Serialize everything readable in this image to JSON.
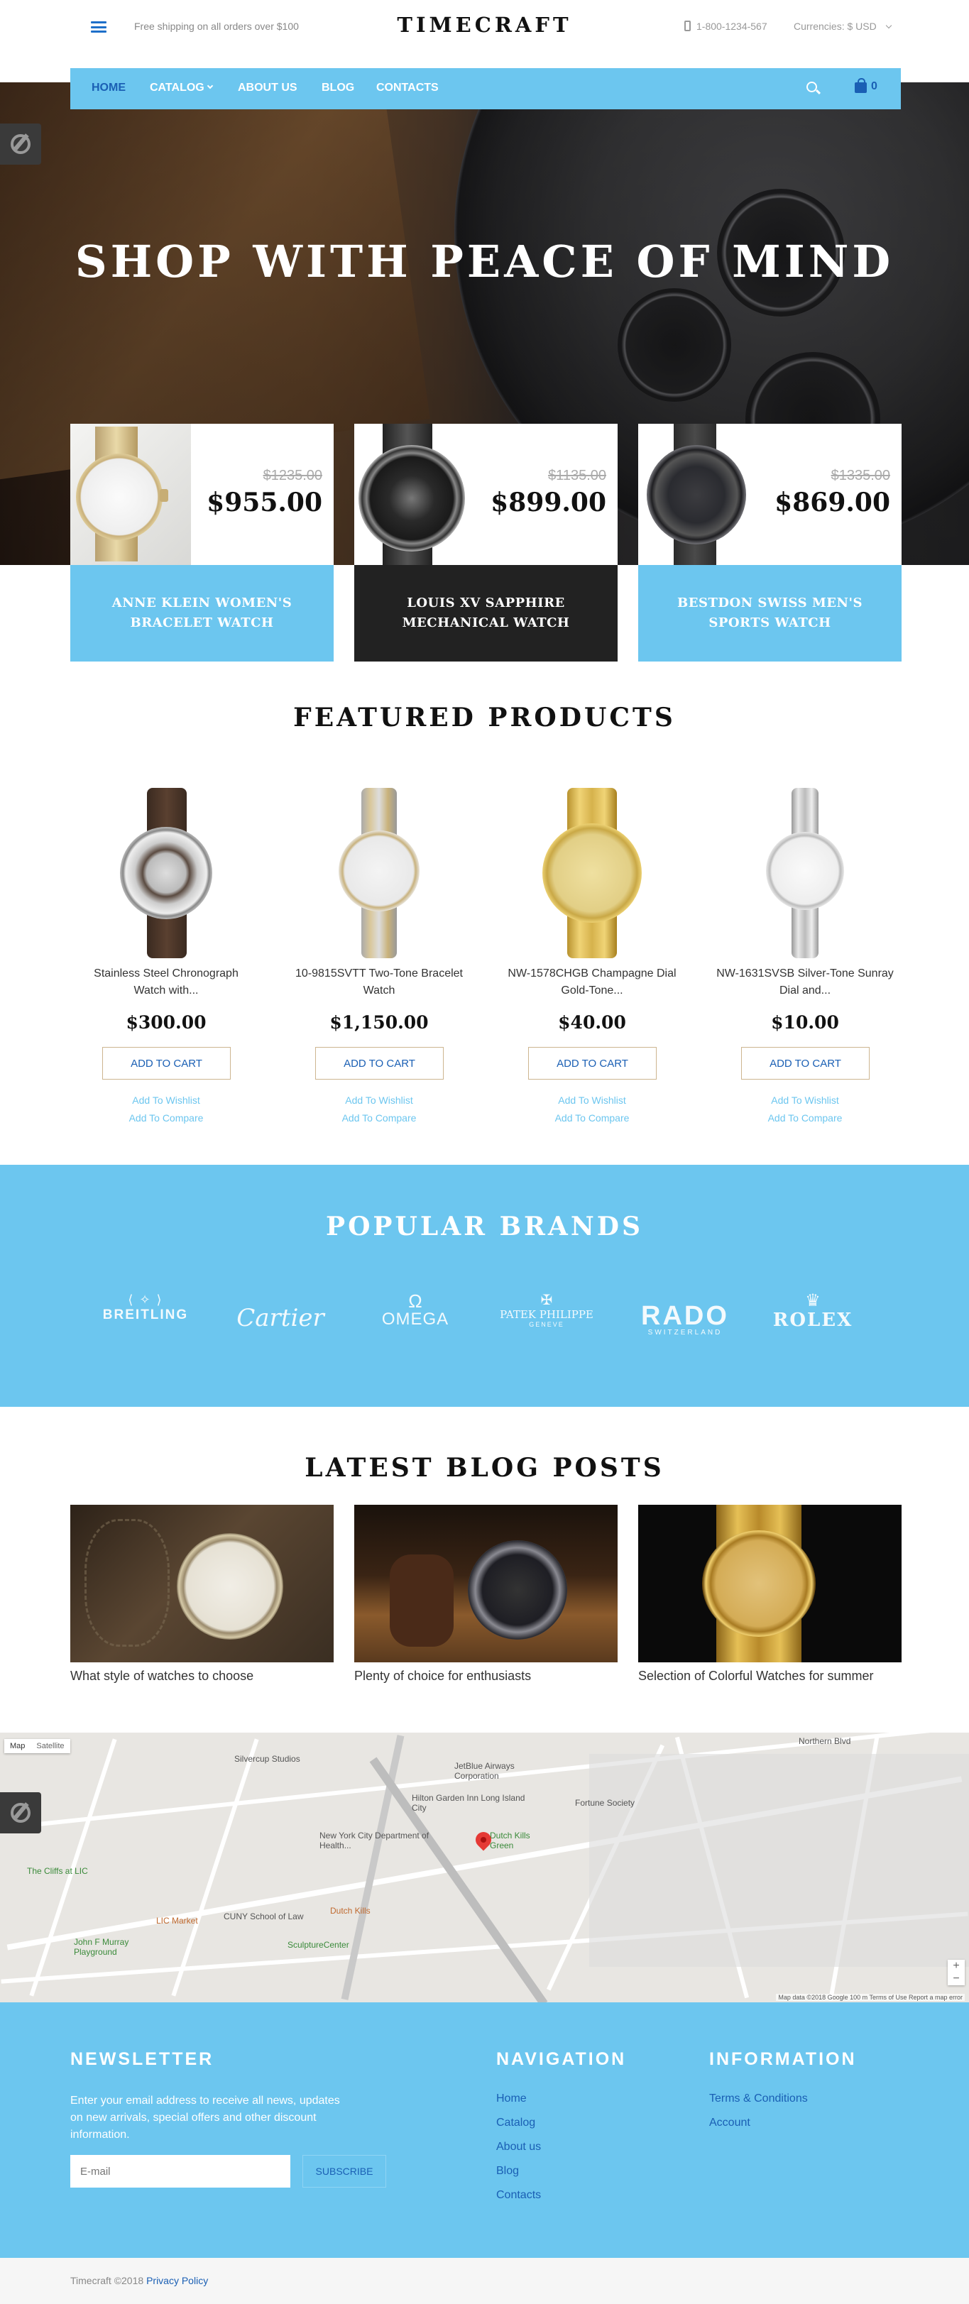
{
  "header": {
    "shipping_text": "Free shipping on all orders over $100",
    "logo": "TIMECRAFT",
    "phone": "1-800-1234-567",
    "currency_label": "Currencies: $ USD"
  },
  "nav": {
    "items": [
      {
        "label": "HOME",
        "active": true
      },
      {
        "label": "CATALOG",
        "active": false
      },
      {
        "label": "ABOUT US",
        "active": false
      },
      {
        "label": "BLOG",
        "active": false
      },
      {
        "label": "CONTACTS",
        "active": false
      }
    ],
    "cart_count": "0"
  },
  "hero": {
    "title": "SHOP WITH PEACE OF MIND"
  },
  "promos": [
    {
      "old_price": "$1235.00",
      "price": "$955.00",
      "title": "ANNE KLEIN WOMEN'S BRACELET WATCH"
    },
    {
      "old_price": "$1135.00",
      "price": "$899.00",
      "title": "LOUIS XV SAPPHIRE MECHANICAL WATCH"
    },
    {
      "old_price": "$1335.00",
      "price": "$869.00",
      "title": "BESTDON SWISS MEN'S SPORTS WATCH"
    }
  ],
  "featured": {
    "title": "FEATURED PRODUCTS",
    "add_to_cart": "ADD TO CART",
    "add_to_wishlist": "Add To Wishlist",
    "add_to_compare": "Add To Compare",
    "products": [
      {
        "name": "Stainless Steel Chronograph Watch with...",
        "price": "$300.00"
      },
      {
        "name": "10-9815SVTT Two-Tone Bracelet Watch",
        "price": "$1,150.00"
      },
      {
        "name": "NW-1578CHGB Champagne Dial Gold-Tone...",
        "price": "$40.00"
      },
      {
        "name": "NW-1631SVSB Silver-Tone Sunray Dial and...",
        "price": "$10.00"
      }
    ]
  },
  "brands": {
    "title": "POPULAR BRANDS",
    "items": [
      {
        "name": "BREITLING",
        "icon": "breitling-wings-icon"
      },
      {
        "name": "Cartier",
        "icon": "cartier-script"
      },
      {
        "name": "OMEGA",
        "icon": "omega-icon"
      },
      {
        "name": "PATEK PHILIPPE",
        "sub": "GENEVE",
        "icon": "patek-cross-icon"
      },
      {
        "name": "RADO",
        "sub": "SWITZERLAND",
        "icon": "rado-wordmark"
      },
      {
        "name": "ROLEX",
        "icon": "rolex-crown-icon"
      }
    ]
  },
  "blog": {
    "title": "LATEST BLOG POSTS",
    "posts": [
      {
        "title": "What style of watches to choose"
      },
      {
        "title": "Plenty of choice for enthusiasts"
      },
      {
        "title": "Selection of Colorful Watches for summer"
      }
    ]
  },
  "map": {
    "type_map": "Map",
    "type_satellite": "Satellite",
    "attribution": "Map data ©2018 Google   100 m   Terms of Use   Report a map error",
    "labels": [
      "Silvercup Studios",
      "JetBlue Airways Corporation",
      "Hilton Garden Inn Long Island City",
      "Fortune Society",
      "New York City Department of Health...",
      "Dutch Kills Green",
      "The Cliffs at LIC",
      "LIC Market",
      "CUNY School of Law",
      "Dutch Kills",
      "John F Murray Playground",
      "SculptureCenter",
      "Northern Blvd"
    ]
  },
  "footer": {
    "newsletter_title": "NEWSLETTER",
    "newsletter_text": "Enter your email address to receive all news, updates on new arrivals, special offers and other discount information.",
    "email_placeholder": "E-mail",
    "subscribe_label": "SUBSCRIBE",
    "navigation_title": "NAVIGATION",
    "navigation_links": [
      "Home",
      "Catalog",
      "About us",
      "Blog",
      "Contacts"
    ],
    "information_title": "INFORMATION",
    "information_links": [
      "Terms & Conditions",
      "Account"
    ],
    "copyright": "Timecraft ©2018",
    "privacy": "Privacy Policy"
  },
  "colors": {
    "accent": "#6cc6ef",
    "link": "#1a5fb4",
    "dark": "#222222"
  }
}
